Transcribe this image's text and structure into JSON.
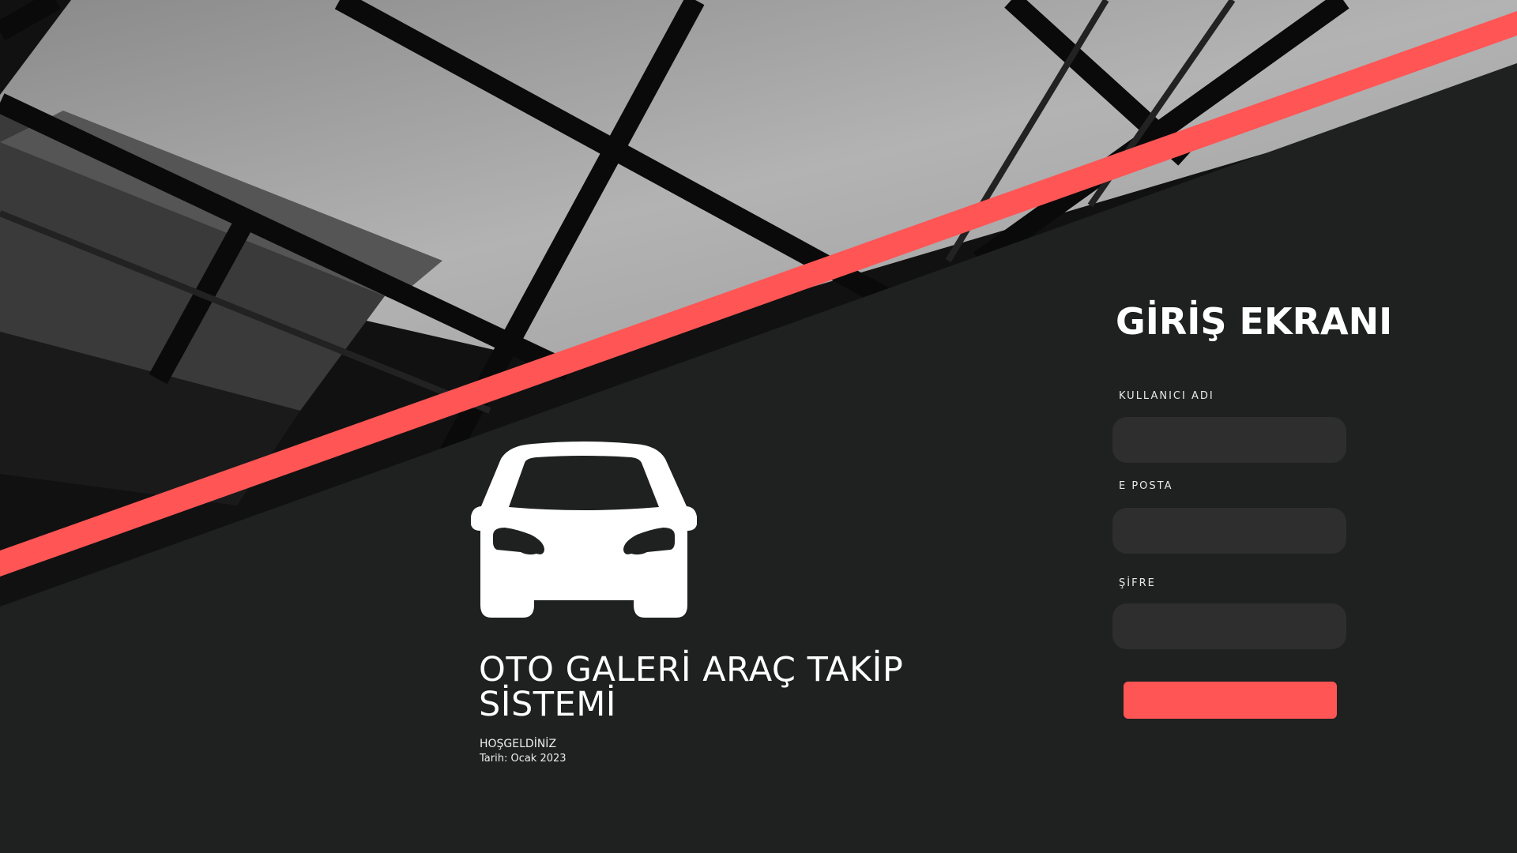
{
  "login": {
    "title": "GİRİŞ EKRANI",
    "username_label": "KULLANICI ADI",
    "username_value": "",
    "email_label": "E POSTA",
    "email_value": "",
    "password_label": "ŞİFRE",
    "password_value": ""
  },
  "hero": {
    "icon": "car-icon",
    "title": "OTO GALERİ ARAÇ TAKİP SİSTEMİ",
    "welcome": "HOŞGELDİNİZ",
    "date": "Tarih: Ocak 2023"
  },
  "colors": {
    "accent": "#ff5555",
    "background": "#1e2120",
    "input": "#2d2e2d"
  }
}
